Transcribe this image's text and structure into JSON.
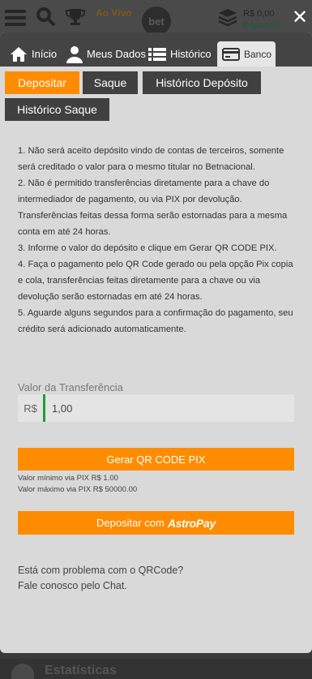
{
  "background": {
    "live_label": "Ao Vivo",
    "logo_text": "bet",
    "balance": "R$ 0,00",
    "deposit_link": "Depositar",
    "footer_text": "Estatísticas"
  },
  "close_symbol": "✕",
  "tabs": {
    "inicio": "Início",
    "meus_dados": "Meus Dados",
    "historico": "Histórico",
    "banco": "Banco"
  },
  "subtabs": {
    "depositar": "Depositar",
    "saque": "Saque",
    "historico_deposito": "Histórico Depósito",
    "historico_saque": "Histórico Saque"
  },
  "rules": [
    "1. Não será aceito depósito vindo de contas de terceiros, somente será creditado o valor para o mesmo titular no Betnacional.",
    "2. Não é permitido transferências diretamente para a chave do intermediador de pagamento, ou via PIX por devolução. Transferências feitas dessa forma serão estornadas para a mesma conta em até 24 horas.",
    "3. Informe o valor do depósito e clique em Gerar QR CODE PIX.",
    "4. Faça o pagamento pelo QR Code gerado ou pela opção Pix copia e cola, transferências feitas diretamente para a chave ou via devolução serão estornadas em até 24 horas.",
    "5. Aguarde alguns segundos para a confirmação do pagamento, seu crédito será adicionado automaticamente."
  ],
  "transfer": {
    "label": "Valor da Transferência",
    "currency": "R$",
    "value": "1,00"
  },
  "pix_button": "Gerar QR CODE PIX",
  "min_value": "Valor mínimo via PIX R$ 1.00",
  "max_value": "Valor máximo via PIX R$ 50000.00",
  "astropay": {
    "label": "Depositar com",
    "brand": "AstroPay"
  },
  "help": {
    "line1": "Está com problema com o QRCode?",
    "line2": "Fale conosco pelo Chat."
  },
  "colors": {
    "accent": "#ff8c00",
    "dark_button": "#404040",
    "input_bar": "#1fa038"
  }
}
